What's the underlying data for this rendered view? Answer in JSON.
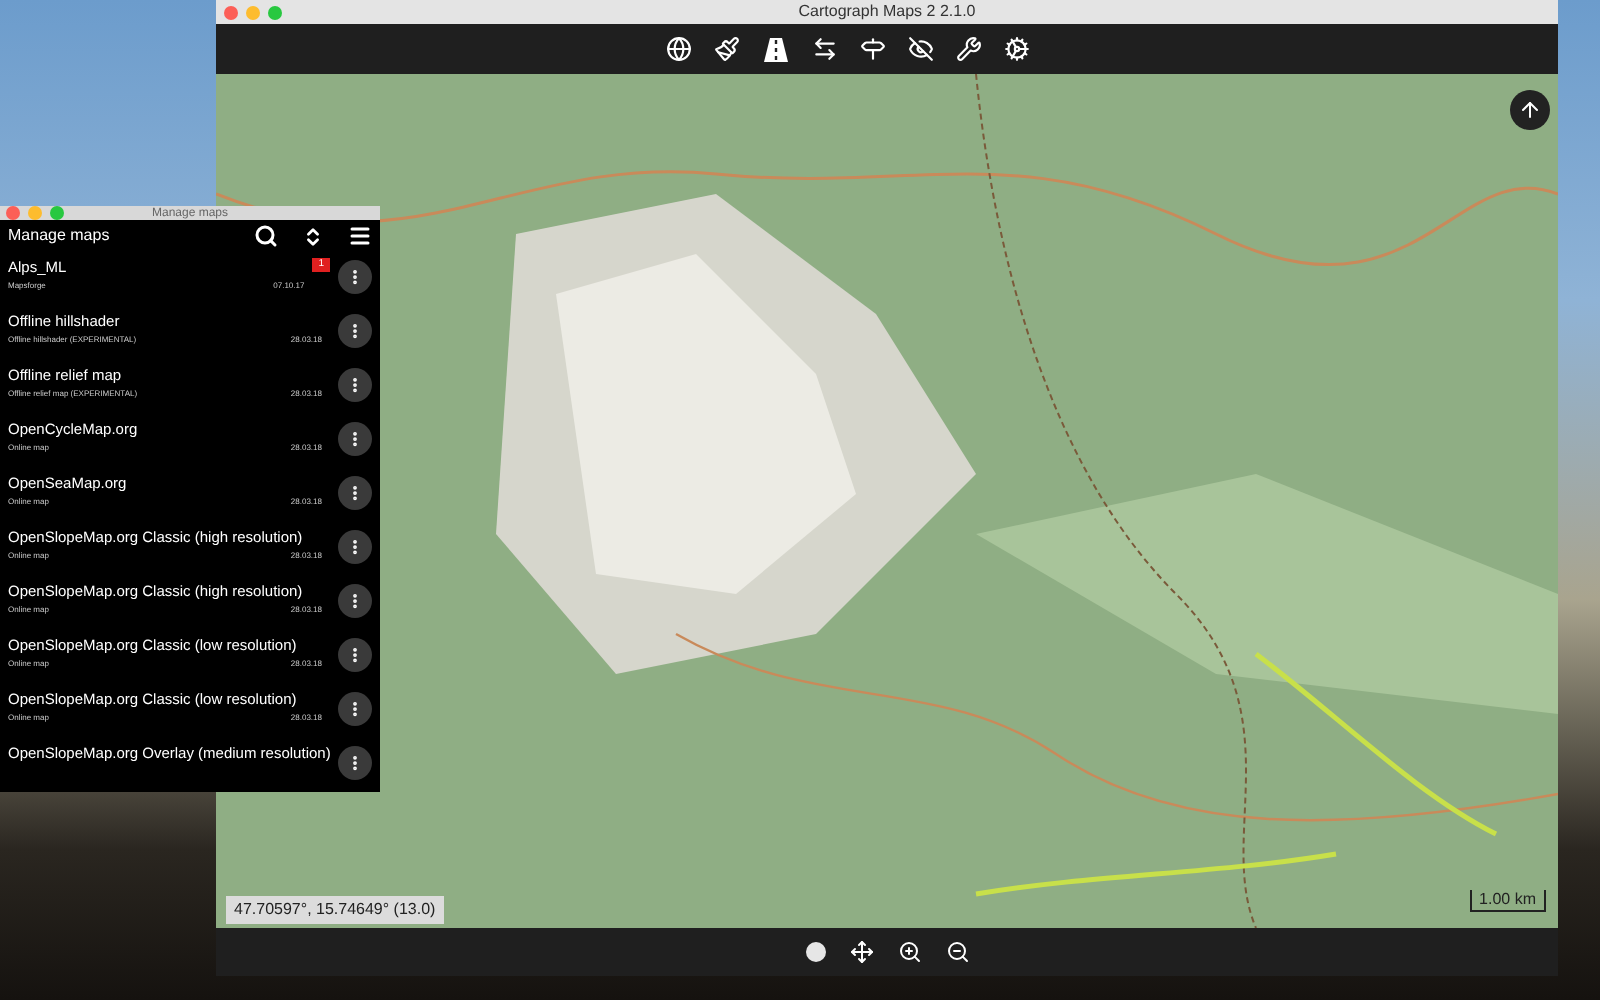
{
  "main_window": {
    "title": "Cartograph Maps 2 2.1.0"
  },
  "map": {
    "coordinates": "47.70597°, 15.74649° (13.0)",
    "scale": "1.00 km"
  },
  "manage_maps": {
    "window_title": "Manage maps",
    "heading": "Manage maps",
    "maps": [
      {
        "name": "Alps_ML",
        "subtitle": "Mapsforge",
        "date": "07.10.17",
        "badge": "1"
      },
      {
        "name": "Offline hillshader",
        "subtitle": "Offline hillshader (EXPERIMENTAL)",
        "date": "28.03.18"
      },
      {
        "name": "Offline relief map",
        "subtitle": "Offline relief map (EXPERIMENTAL)",
        "date": "28.03.18"
      },
      {
        "name": "OpenCycleMap.org",
        "subtitle": "Online map",
        "date": "28.03.18"
      },
      {
        "name": "OpenSeaMap.org",
        "subtitle": "Online map",
        "date": "28.03.18"
      },
      {
        "name": "OpenSlopeMap.org Classic (high resolution)",
        "subtitle": "Online map",
        "date": "28.03.18"
      },
      {
        "name": "OpenSlopeMap.org Classic (high resolution)",
        "subtitle": "Online map",
        "date": "28.03.18"
      },
      {
        "name": "OpenSlopeMap.org Classic (low resolution)",
        "subtitle": "Online map",
        "date": "28.03.18"
      },
      {
        "name": "OpenSlopeMap.org Classic (low resolution)",
        "subtitle": "Online map",
        "date": "28.03.18"
      },
      {
        "name": "OpenSlopeMap.org Overlay (medium resolution)"
      }
    ]
  }
}
